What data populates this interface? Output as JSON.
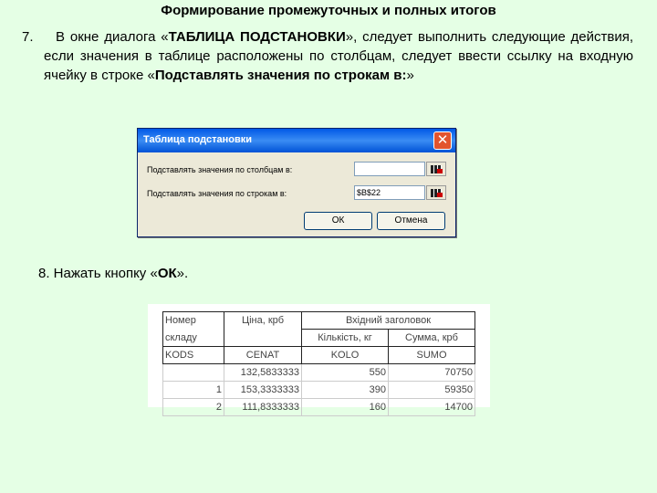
{
  "title": "Формирование промежуточных и полных итогов",
  "step7": {
    "number": "7.",
    "text_prefix": "В окне диалога «",
    "dialog_name": "ТАБЛИЦА ПОДСТАНОВКИ",
    "text_middle": "», следует выполнить следующие действия, если значения в таблице расположены по столбцам, следует ввести ссылку на входную ячейку в строке «",
    "row_label_bold": "Подставлять значения по строкам в:",
    "text_suffix": "»"
  },
  "dialog": {
    "title": "Таблица подстановки",
    "close_glyph": "✕",
    "columns_label": "Подставлять значения по столбцам в:",
    "columns_value": "",
    "rows_label": "Подставлять значения по строкам в:",
    "rows_value": "$B$22",
    "ok_label": "ОК",
    "cancel_label": "Отмена"
  },
  "step8": {
    "prefix": "8. Нажать кнопку «",
    "button": "ОК",
    "suffix": "»."
  },
  "sheet": {
    "header_row1": [
      "Номер",
      "Ціна, крб",
      "Вхідний заголовок"
    ],
    "header_row1b": [
      "складу"
    ],
    "header_row2": [
      "Кількість, кг",
      "Сумма, крб"
    ],
    "header_row3": [
      "KODS",
      "CENAT",
      "KOLO",
      "SUMO"
    ],
    "rows": [
      [
        "",
        "132,5833333",
        "550",
        "70750"
      ],
      [
        "1",
        "153,3333333",
        "390",
        "59350"
      ],
      [
        "2",
        "111,8333333",
        "160",
        "14700"
      ]
    ]
  }
}
